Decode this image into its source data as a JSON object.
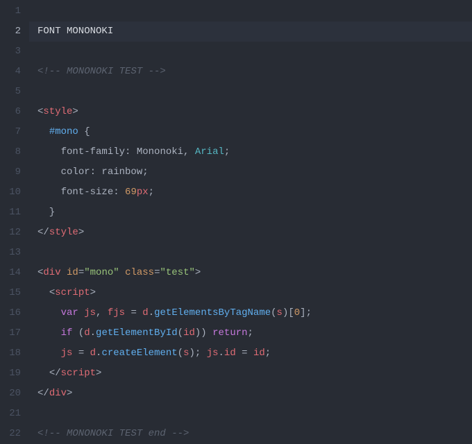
{
  "editor": {
    "active_line": 2,
    "lines": [
      {
        "n": 1,
        "tokens": []
      },
      {
        "n": 2,
        "tokens": [
          {
            "t": "FONT MONONOKI",
            "c": "c-title"
          }
        ]
      },
      {
        "n": 3,
        "tokens": []
      },
      {
        "n": 4,
        "tokens": [
          {
            "t": "<!-- MONONOKI TEST -->",
            "c": "c-comment"
          }
        ]
      },
      {
        "n": 5,
        "tokens": []
      },
      {
        "n": 6,
        "tokens": [
          {
            "t": "<",
            "c": "c-punct"
          },
          {
            "t": "style",
            "c": "c-tag"
          },
          {
            "t": ">",
            "c": "c-punct"
          }
        ]
      },
      {
        "n": 7,
        "tokens": [
          {
            "t": "  ",
            "c": "c-plain"
          },
          {
            "t": "#mono",
            "c": "c-id"
          },
          {
            "t": " {",
            "c": "c-plain"
          }
        ]
      },
      {
        "n": 8,
        "tokens": [
          {
            "t": "    ",
            "c": "c-plain"
          },
          {
            "t": "font-family",
            "c": "c-prop"
          },
          {
            "t": ": Mononoki, ",
            "c": "c-plain"
          },
          {
            "t": "Arial",
            "c": "c-teal"
          },
          {
            "t": ";",
            "c": "c-plain"
          }
        ]
      },
      {
        "n": 9,
        "tokens": [
          {
            "t": "    ",
            "c": "c-plain"
          },
          {
            "t": "color",
            "c": "c-prop"
          },
          {
            "t": ": rainbow;",
            "c": "c-plain"
          }
        ]
      },
      {
        "n": 10,
        "tokens": [
          {
            "t": "    ",
            "c": "c-plain"
          },
          {
            "t": "font-size",
            "c": "c-prop"
          },
          {
            "t": ": ",
            "c": "c-plain"
          },
          {
            "t": "69",
            "c": "c-num"
          },
          {
            "t": "px",
            "c": "c-tag"
          },
          {
            "t": ";",
            "c": "c-plain"
          }
        ]
      },
      {
        "n": 11,
        "tokens": [
          {
            "t": "  }",
            "c": "c-plain"
          }
        ]
      },
      {
        "n": 12,
        "tokens": [
          {
            "t": "</",
            "c": "c-punct"
          },
          {
            "t": "style",
            "c": "c-tag"
          },
          {
            "t": ">",
            "c": "c-punct"
          }
        ]
      },
      {
        "n": 13,
        "tokens": []
      },
      {
        "n": 14,
        "tokens": [
          {
            "t": "<",
            "c": "c-punct"
          },
          {
            "t": "div",
            "c": "c-tag"
          },
          {
            "t": " ",
            "c": "c-plain"
          },
          {
            "t": "id",
            "c": "c-attr"
          },
          {
            "t": "=",
            "c": "c-plain"
          },
          {
            "t": "\"mono\"",
            "c": "c-string"
          },
          {
            "t": " ",
            "c": "c-plain"
          },
          {
            "t": "class",
            "c": "c-attr"
          },
          {
            "t": "=",
            "c": "c-plain"
          },
          {
            "t": "\"test\"",
            "c": "c-string"
          },
          {
            "t": ">",
            "c": "c-punct"
          }
        ]
      },
      {
        "n": 15,
        "tokens": [
          {
            "t": "  ",
            "c": "c-plain"
          },
          {
            "t": "<",
            "c": "c-punct"
          },
          {
            "t": "script",
            "c": "c-tag"
          },
          {
            "t": ">",
            "c": "c-punct"
          }
        ]
      },
      {
        "n": 16,
        "tokens": [
          {
            "t": "    ",
            "c": "c-plain"
          },
          {
            "t": "var",
            "c": "c-varkey"
          },
          {
            "t": " ",
            "c": "c-plain"
          },
          {
            "t": "js",
            "c": "c-red"
          },
          {
            "t": ", ",
            "c": "c-plain"
          },
          {
            "t": "fjs",
            "c": "c-red"
          },
          {
            "t": " = ",
            "c": "c-plain"
          },
          {
            "t": "d",
            "c": "c-red"
          },
          {
            "t": ".",
            "c": "c-plain"
          },
          {
            "t": "getElementsByTagName",
            "c": "c-func"
          },
          {
            "t": "(",
            "c": "c-plain"
          },
          {
            "t": "s",
            "c": "c-red"
          },
          {
            "t": ")[",
            "c": "c-plain"
          },
          {
            "t": "0",
            "c": "c-num"
          },
          {
            "t": "];",
            "c": "c-plain"
          }
        ]
      },
      {
        "n": 17,
        "tokens": [
          {
            "t": "    ",
            "c": "c-plain"
          },
          {
            "t": "if",
            "c": "c-keyword"
          },
          {
            "t": " (",
            "c": "c-plain"
          },
          {
            "t": "d",
            "c": "c-red"
          },
          {
            "t": ".",
            "c": "c-plain"
          },
          {
            "t": "getElementById",
            "c": "c-func"
          },
          {
            "t": "(",
            "c": "c-plain"
          },
          {
            "t": "id",
            "c": "c-red"
          },
          {
            "t": ")) ",
            "c": "c-plain"
          },
          {
            "t": "return",
            "c": "c-keyword"
          },
          {
            "t": ";",
            "c": "c-plain"
          }
        ]
      },
      {
        "n": 18,
        "tokens": [
          {
            "t": "    ",
            "c": "c-plain"
          },
          {
            "t": "js",
            "c": "c-red"
          },
          {
            "t": " = ",
            "c": "c-plain"
          },
          {
            "t": "d",
            "c": "c-red"
          },
          {
            "t": ".",
            "c": "c-plain"
          },
          {
            "t": "createElement",
            "c": "c-func"
          },
          {
            "t": "(",
            "c": "c-plain"
          },
          {
            "t": "s",
            "c": "c-red"
          },
          {
            "t": "); ",
            "c": "c-plain"
          },
          {
            "t": "js",
            "c": "c-red"
          },
          {
            "t": ".",
            "c": "c-plain"
          },
          {
            "t": "id",
            "c": "c-red"
          },
          {
            "t": " = ",
            "c": "c-plain"
          },
          {
            "t": "id",
            "c": "c-red"
          },
          {
            "t": ";",
            "c": "c-plain"
          }
        ]
      },
      {
        "n": 19,
        "tokens": [
          {
            "t": "  ",
            "c": "c-plain"
          },
          {
            "t": "</",
            "c": "c-punct"
          },
          {
            "t": "script",
            "c": "c-tag"
          },
          {
            "t": ">",
            "c": "c-punct"
          }
        ]
      },
      {
        "n": 20,
        "tokens": [
          {
            "t": "</",
            "c": "c-punct"
          },
          {
            "t": "div",
            "c": "c-tag"
          },
          {
            "t": ">",
            "c": "c-punct"
          }
        ]
      },
      {
        "n": 21,
        "tokens": []
      },
      {
        "n": 22,
        "tokens": [
          {
            "t": "<!-- MONONOKI TEST end -->",
            "c": "c-comment"
          }
        ]
      }
    ]
  }
}
